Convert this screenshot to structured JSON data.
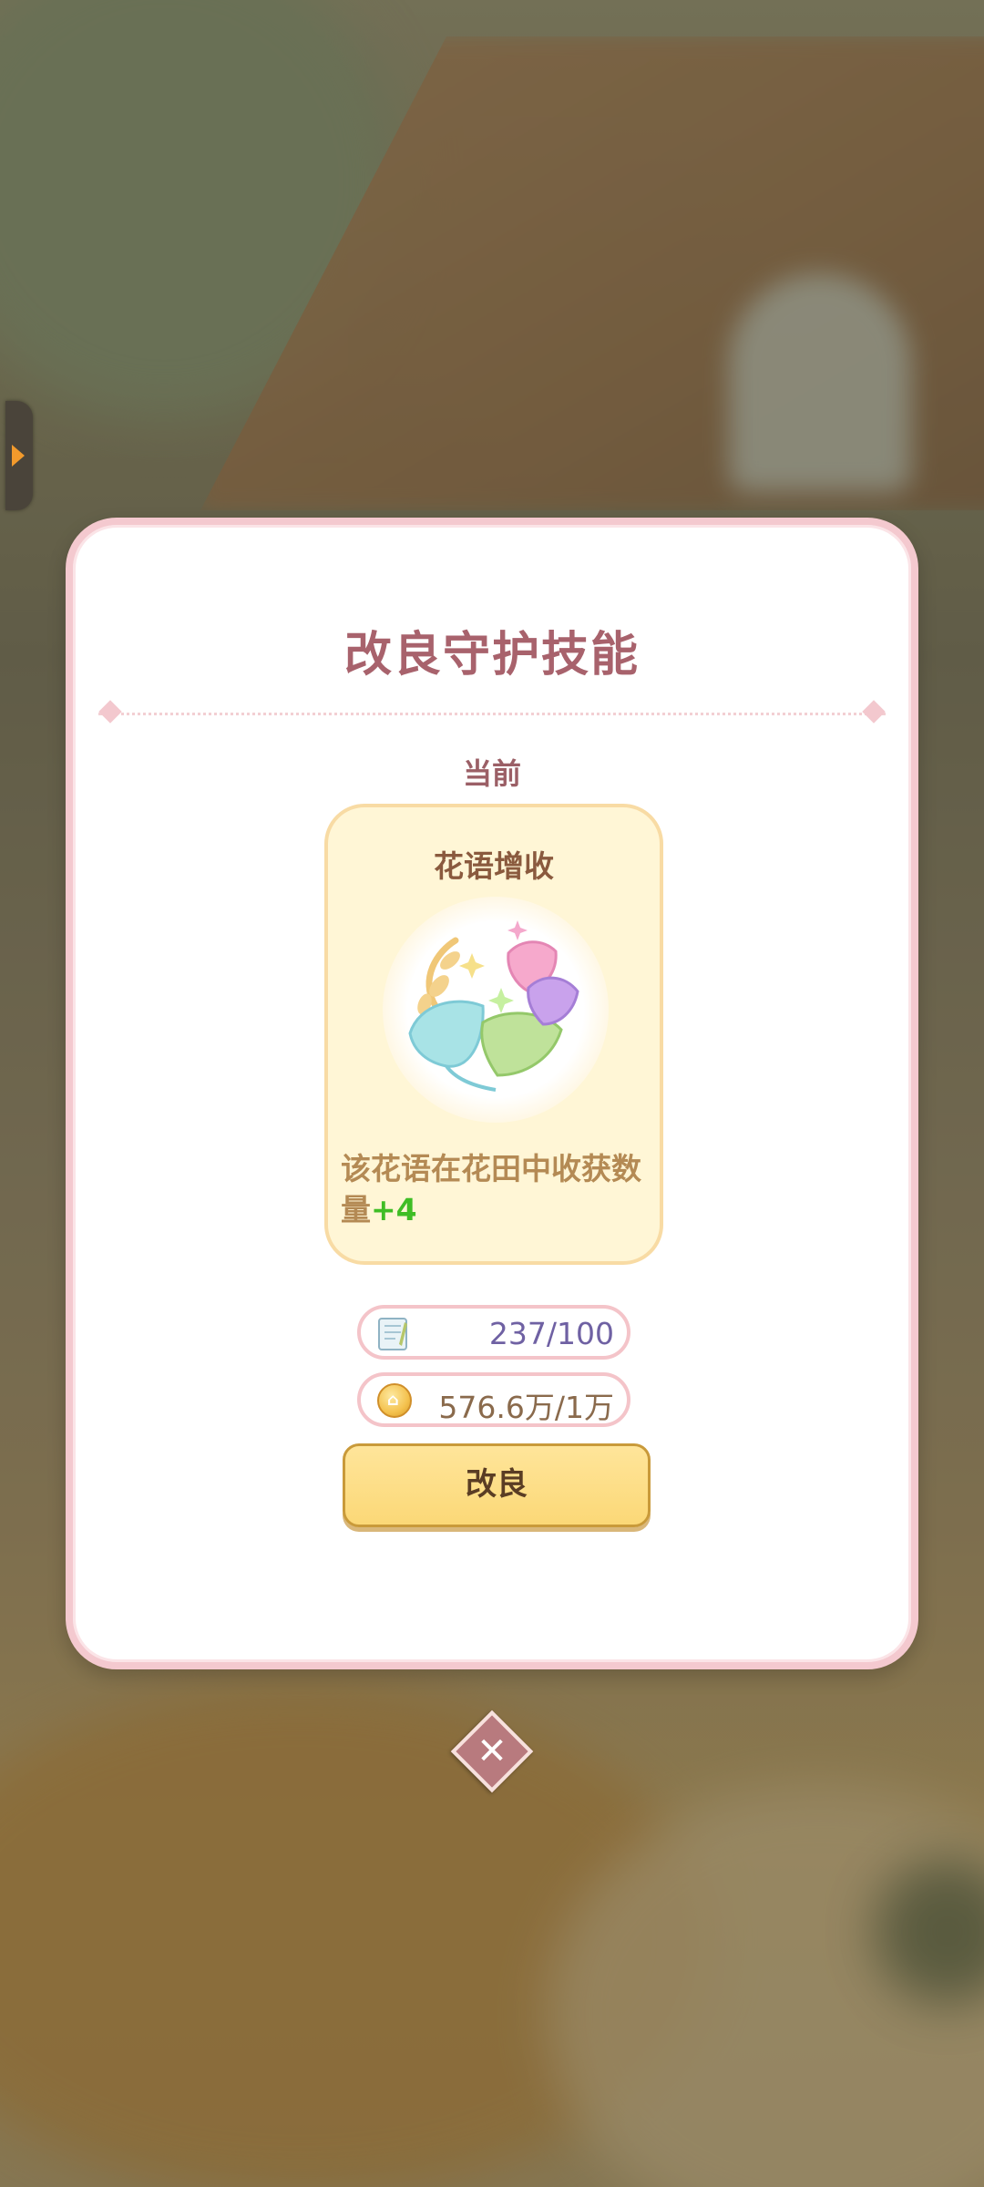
{
  "dialog": {
    "title": "改良守护技能",
    "current_label": "当前"
  },
  "skill": {
    "name": "花语增收",
    "description": "该花语在花田中收获数量",
    "bonus": "+4",
    "icon": "flower-bouquet-icon"
  },
  "resources": {
    "notes": {
      "icon": "notebook-icon",
      "value": "237/100"
    },
    "coins": {
      "icon": "coin-icon",
      "value": "576.6万/1万"
    }
  },
  "buttons": {
    "improve_label": "改良",
    "close_label": "✕"
  },
  "colors": {
    "title": "#a8626c",
    "card_bg": "#fff6d6",
    "bonus": "#3fbd25",
    "button": "#fbd877",
    "border_pink": "#f4c9cf"
  }
}
